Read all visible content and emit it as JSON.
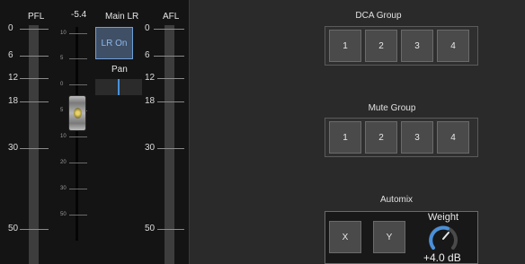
{
  "channel": {
    "pfl_label": "PFL",
    "afl_label": "AFL",
    "fader_level": "-5.4",
    "main_lr_label": "Main LR",
    "lr_button_label": "LR On",
    "pan_label": "Pan",
    "meter_scale": [
      "0",
      "6",
      "12",
      "18",
      "30",
      "50"
    ],
    "fader_scale": [
      "10",
      "5",
      "0",
      "5",
      "10",
      "20",
      "30",
      "50"
    ]
  },
  "dca_group": {
    "title": "DCA Group",
    "buttons": [
      "1",
      "2",
      "3",
      "4"
    ]
  },
  "mute_group": {
    "title": "Mute Group",
    "buttons": [
      "1",
      "2",
      "3",
      "4"
    ]
  },
  "automix": {
    "title": "Automix",
    "x_label": "X",
    "y_label": "Y",
    "weight_label": "Weight",
    "weight_value": "+4.0 dB"
  },
  "colors": {
    "accent": "#4a90d9",
    "lr_on_text": "#8fb8e8"
  }
}
